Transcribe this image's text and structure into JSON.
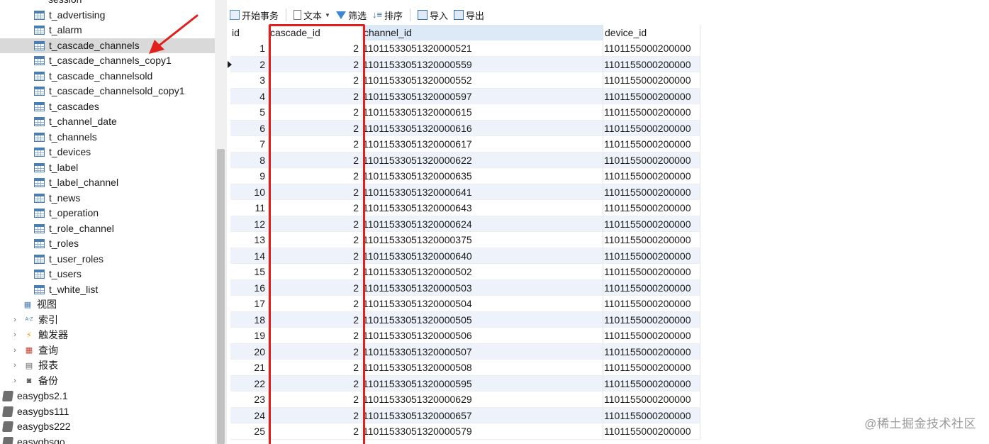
{
  "navigator": {
    "top_cut_label": "session",
    "tables": [
      "t_advertising",
      "t_alarm",
      "t_cascade_channels",
      "t_cascade_channels_copy1",
      "t_cascade_channelsold",
      "t_cascade_channelsold_copy1",
      "t_cascades",
      "t_channel_date",
      "t_channels",
      "t_devices",
      "t_label",
      "t_label_channel",
      "t_news",
      "t_operation",
      "t_role_channel",
      "t_roles",
      "t_user_roles",
      "t_users",
      "t_white_list"
    ],
    "selected_table": "t_cascade_channels",
    "views_label": "视图",
    "groups": [
      {
        "label": "索引",
        "icon": "index-icon",
        "glyph": "A-Z"
      },
      {
        "label": "触发器",
        "icon": "trigger-icon",
        "glyph": "⚡"
      },
      {
        "label": "查询",
        "icon": "query-icon",
        "glyph": "▦"
      },
      {
        "label": "报表",
        "icon": "report-icon",
        "glyph": "▤"
      },
      {
        "label": "备份",
        "icon": "backup-icon",
        "glyph": "◙"
      }
    ],
    "databases": [
      "easygbs2.1",
      "easygbs111",
      "easygbs222",
      "easygbsgo"
    ]
  },
  "toolbar": {
    "begin_transaction": "开始事务",
    "text": "文本",
    "filter": "筛选",
    "sort": "排序",
    "import": "导入",
    "export": "导出"
  },
  "grid": {
    "columns": [
      "id",
      "cascade_id",
      "channel_id",
      "device_id"
    ],
    "current_row": 2,
    "rows": [
      [
        "1",
        "2",
        "11011533051320000521",
        "1101155000200000"
      ],
      [
        "2",
        "2",
        "11011533051320000559",
        "1101155000200000"
      ],
      [
        "3",
        "2",
        "11011533051320000552",
        "1101155000200000"
      ],
      [
        "4",
        "2",
        "11011533051320000597",
        "1101155000200000"
      ],
      [
        "5",
        "2",
        "11011533051320000615",
        "1101155000200000"
      ],
      [
        "6",
        "2",
        "11011533051320000616",
        "1101155000200000"
      ],
      [
        "7",
        "2",
        "11011533051320000617",
        "1101155000200000"
      ],
      [
        "8",
        "2",
        "11011533051320000622",
        "1101155000200000"
      ],
      [
        "9",
        "2",
        "11011533051320000635",
        "1101155000200000"
      ],
      [
        "10",
        "2",
        "11011533051320000641",
        "1101155000200000"
      ],
      [
        "11",
        "2",
        "11011533051320000643",
        "1101155000200000"
      ],
      [
        "12",
        "2",
        "11011533051320000624",
        "1101155000200000"
      ],
      [
        "13",
        "2",
        "11011533051320000375",
        "1101155000200000"
      ],
      [
        "14",
        "2",
        "11011533051320000640",
        "1101155000200000"
      ],
      [
        "15",
        "2",
        "11011533051320000502",
        "1101155000200000"
      ],
      [
        "16",
        "2",
        "11011533051320000503",
        "1101155000200000"
      ],
      [
        "17",
        "2",
        "11011533051320000504",
        "1101155000200000"
      ],
      [
        "18",
        "2",
        "11011533051320000505",
        "1101155000200000"
      ],
      [
        "19",
        "2",
        "11011533051320000506",
        "1101155000200000"
      ],
      [
        "20",
        "2",
        "11011533051320000507",
        "1101155000200000"
      ],
      [
        "21",
        "2",
        "11011533051320000508",
        "1101155000200000"
      ],
      [
        "22",
        "2",
        "11011533051320000595",
        "1101155000200000"
      ],
      [
        "23",
        "2",
        "11011533051320000629",
        "1101155000200000"
      ],
      [
        "24",
        "2",
        "11011533051320000657",
        "1101155000200000"
      ],
      [
        "25",
        "2",
        "11011533051320000579",
        "1101155000200000"
      ]
    ]
  },
  "annotation_color": "#e0201d",
  "watermark": "@稀土掘金技术社区"
}
